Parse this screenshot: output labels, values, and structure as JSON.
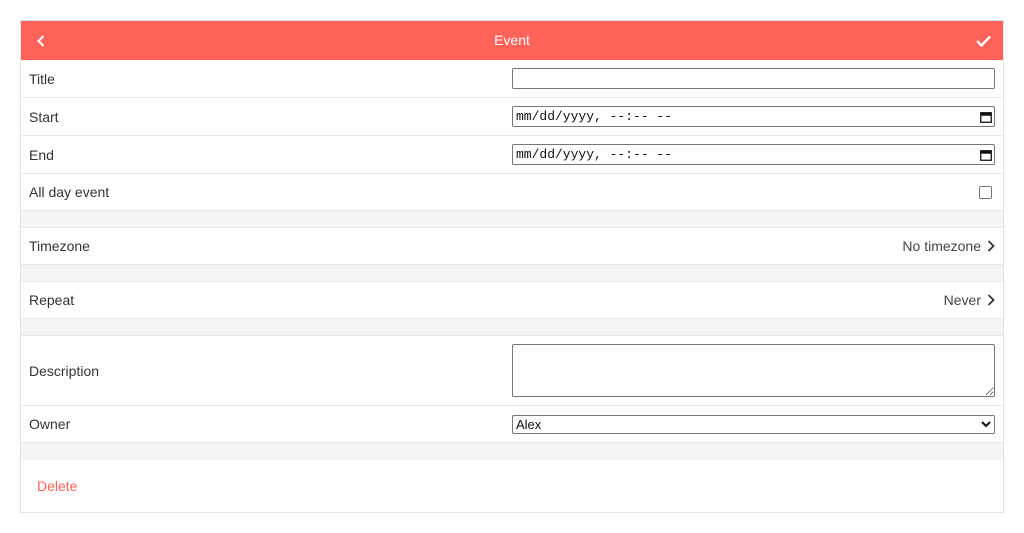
{
  "header": {
    "title": "Event",
    "back_icon": "chevron-left-icon",
    "save_icon": "checkmark-icon",
    "accent_color": "#ff6258"
  },
  "form": {
    "title_label": "Title",
    "title_value": "",
    "start_label": "Start",
    "start_placeholder": "mm/dd/yyyy, --:-- --",
    "end_label": "End",
    "end_placeholder": "mm/dd/yyyy, --:-- --",
    "all_day_label": "All day event",
    "all_day_checked": false,
    "timezone_label": "Timezone",
    "timezone_value": "No timezone",
    "repeat_label": "Repeat",
    "repeat_value": "Never",
    "description_label": "Description",
    "description_value": "",
    "owner_label": "Owner",
    "owner_value": "Alex"
  },
  "actions": {
    "delete_label": "Delete"
  }
}
